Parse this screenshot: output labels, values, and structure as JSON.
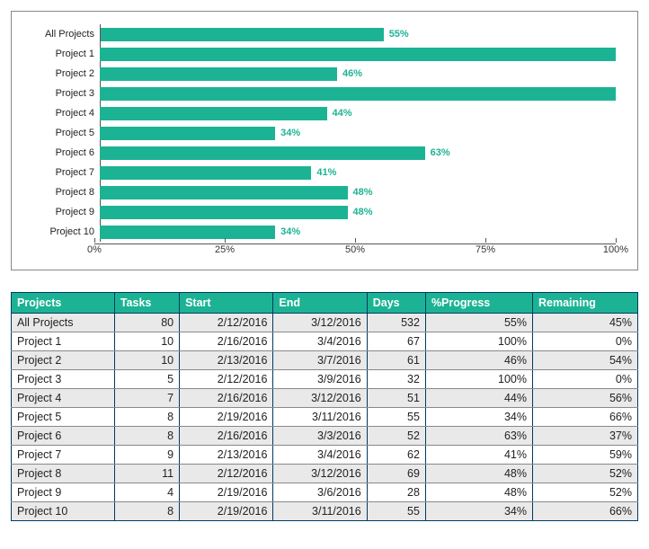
{
  "chart_data": {
    "type": "bar",
    "orientation": "horizontal",
    "categories": [
      "All Projects",
      "Project 1",
      "Project 2",
      "Project 3",
      "Project 4",
      "Project 5",
      "Project 6",
      "Project 7",
      "Project 8",
      "Project 9",
      "Project 10"
    ],
    "values": [
      55,
      100,
      46,
      100,
      44,
      34,
      63,
      41,
      48,
      48,
      34
    ],
    "value_suffix": "%",
    "xlabel": "",
    "ylabel": "",
    "x_ticks": [
      "0%",
      "25%",
      "50%",
      "75%",
      "100%"
    ],
    "xlim": [
      0,
      100
    ],
    "bar_color": "#1cb394",
    "hide_label_at_100": true
  },
  "table": {
    "columns": [
      "Projects",
      "Tasks",
      "Start",
      "End",
      "Days",
      "%Progress",
      "Remaining"
    ],
    "column_align": [
      "left",
      "right",
      "right",
      "right",
      "right",
      "right",
      "right"
    ],
    "rows": [
      {
        "project": "All Projects",
        "tasks": 80,
        "start": "2/12/2016",
        "end": "3/12/2016",
        "days": 532,
        "progress": "55%",
        "remaining": "45%"
      },
      {
        "project": "Project 1",
        "tasks": 10,
        "start": "2/16/2016",
        "end": "3/4/2016",
        "days": 67,
        "progress": "100%",
        "remaining": "0%"
      },
      {
        "project": "Project 2",
        "tasks": 10,
        "start": "2/13/2016",
        "end": "3/7/2016",
        "days": 61,
        "progress": "46%",
        "remaining": "54%"
      },
      {
        "project": "Project 3",
        "tasks": 5,
        "start": "2/12/2016",
        "end": "3/9/2016",
        "days": 32,
        "progress": "100%",
        "remaining": "0%"
      },
      {
        "project": "Project 4",
        "tasks": 7,
        "start": "2/16/2016",
        "end": "3/12/2016",
        "days": 51,
        "progress": "44%",
        "remaining": "56%"
      },
      {
        "project": "Project 5",
        "tasks": 8,
        "start": "2/19/2016",
        "end": "3/11/2016",
        "days": 55,
        "progress": "34%",
        "remaining": "66%"
      },
      {
        "project": "Project 6",
        "tasks": 8,
        "start": "2/16/2016",
        "end": "3/3/2016",
        "days": 52,
        "progress": "63%",
        "remaining": "37%"
      },
      {
        "project": "Project 7",
        "tasks": 9,
        "start": "2/13/2016",
        "end": "3/4/2016",
        "days": 62,
        "progress": "41%",
        "remaining": "59%"
      },
      {
        "project": "Project 8",
        "tasks": 11,
        "start": "2/12/2016",
        "end": "3/12/2016",
        "days": 69,
        "progress": "48%",
        "remaining": "52%"
      },
      {
        "project": "Project 9",
        "tasks": 4,
        "start": "2/19/2016",
        "end": "3/6/2016",
        "days": 28,
        "progress": "48%",
        "remaining": "52%"
      },
      {
        "project": "Project 10",
        "tasks": 8,
        "start": "2/19/2016",
        "end": "3/11/2016",
        "days": 55,
        "progress": "34%",
        "remaining": "66%"
      }
    ]
  }
}
